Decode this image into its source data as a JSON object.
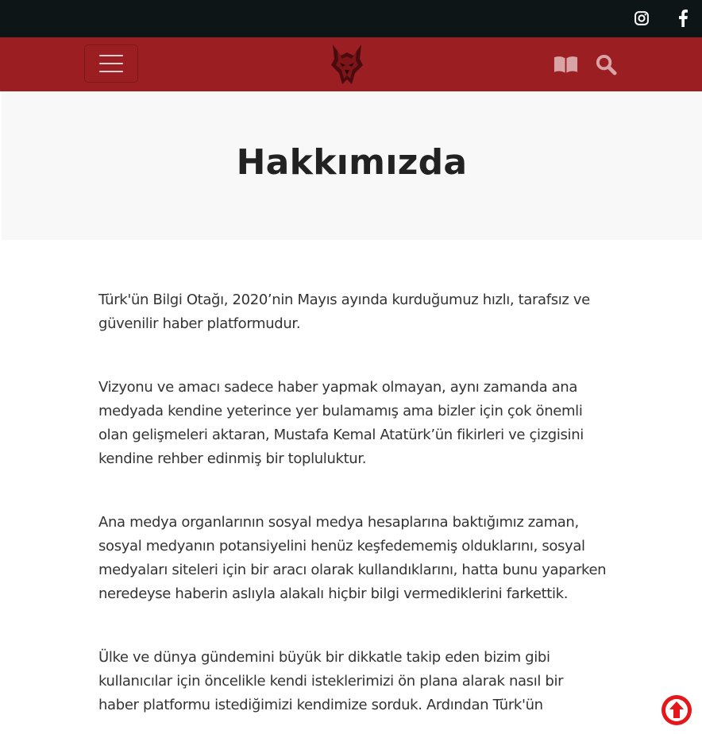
{
  "topbar": {
    "social": [
      {
        "name": "instagram-icon"
      },
      {
        "name": "facebook-icon"
      }
    ]
  },
  "navbar": {
    "menu_icon": "hamburger-menu-icon",
    "logo": "wolf-head-logo",
    "book_icon": "book-open-icon",
    "search_icon": "search-icon"
  },
  "page": {
    "title": "Hakkımızda"
  },
  "content": {
    "paragraphs": [
      "Türk'ün Bilgi Otağı, 2020’nin Mayıs ayında kurduğumuz hızlı, tarafsız ve güvenilir haber platformudur.",
      "Vizyonu ve amacı sadece haber yapmak olmayan, aynı zamanda ana medyada kendine yeterince yer bulamamış ama bizler için çok önemli olan gelişmeleri aktaran, Mustafa Kemal Atatürk’ün fikirleri ve çizgisini kendine rehber edinmiş bir topluluktur.",
      "Ana medya organlarının sosyal medya hesaplarına baktığımız zaman, sosyal medyanın potansiyelini henüz keşfedememiş olduklarını, sosyal medyaları siteleri için bir aracı olarak kullandıklarını, hatta bunu yaparken neredeyse haberin aslıyla alakalı hiçbir bilgi vermediklerini farkettik.",
      "Ülke ve dünya gündemini büyük bir dikkatle takip eden bizim gibi kullanıcılar için öncelikle kendi isteklerimizi ön plana alarak nasıl bir haber platformu istediğimizi kendimize sorduk. Ardından Türk'ün"
    ]
  },
  "colors": {
    "topbar": "#0e1517",
    "navbar": "#9b1f22",
    "hero_bg": "#f8f8f8",
    "scroll_top": "#e4181b"
  },
  "scroll_top_icon": "arrow-up-circle-icon"
}
